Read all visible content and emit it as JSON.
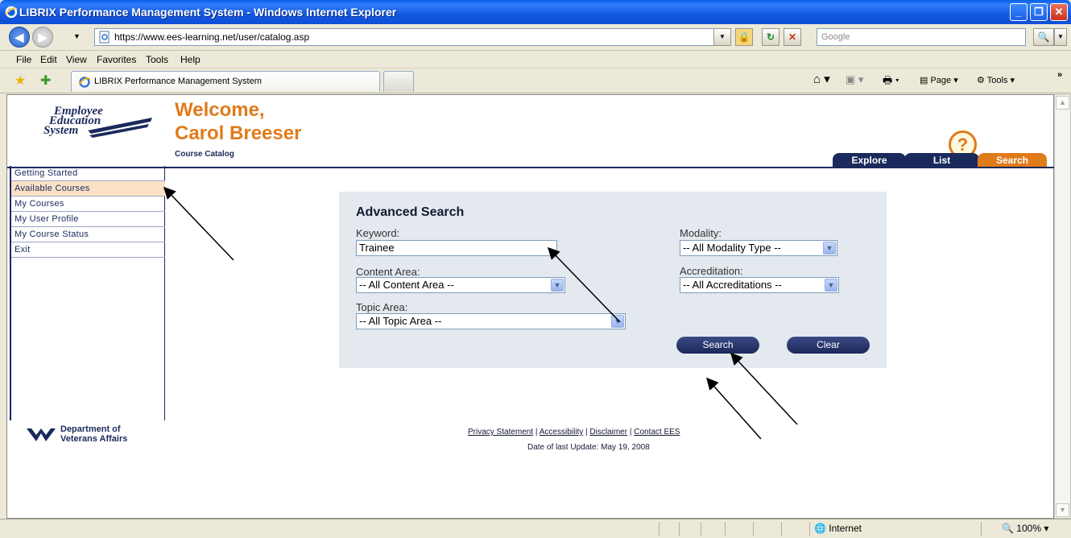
{
  "window": {
    "title": "LIBRIX Performance Management System - Windows Internet Explorer"
  },
  "address": {
    "url": "https://www.ees-learning.net/user/catalog.asp",
    "search_placeholder": "Google"
  },
  "menu": [
    "File",
    "Edit",
    "View",
    "Favorites",
    "Tools",
    "Help"
  ],
  "browser_tab": {
    "label": "LIBRIX Performance Management System"
  },
  "toolbar": {
    "page_label": "Page",
    "tools_label": "Tools"
  },
  "page": {
    "logo": {
      "line1": "Employee",
      "line2": "Education",
      "line3": "System"
    },
    "welcome_line1": "Welcome,",
    "welcome_line2": "Carol Breeser",
    "section": "Course Catalog",
    "help_icon_glyph": "?",
    "tabs": [
      "Explore",
      "List",
      "Search"
    ],
    "left_nav": [
      "Getting Started",
      "Available Courses",
      "My Courses",
      "My User Profile",
      "My Course Status",
      "Exit"
    ],
    "active_nav": "Available Courses"
  },
  "search": {
    "heading": "Advanced Search",
    "keyword_label": "Keyword:",
    "keyword_value": "Trainee",
    "content_area_label": "Content Area:",
    "content_area_value": "-- All Content Area --",
    "topic_area_label": "Topic Area:",
    "topic_area_value": "-- All Topic Area --",
    "modality_label": "Modality:",
    "modality_value": "-- All Modality Type --",
    "accreditation_label": "Accreditation:",
    "accreditation_value": "-- All Accreditations --",
    "search_button": "Search",
    "clear_button": "Clear"
  },
  "footer": {
    "va_line1": "Department of",
    "va_line2": "Veterans Affairs",
    "links": [
      "Privacy Statement",
      "Accessibility",
      "Disclaimer",
      "Contact EES"
    ],
    "separator": " | ",
    "date": "Date of last Update: May 19, 2008"
  },
  "status": {
    "zone": "Internet",
    "zoom": "100%"
  },
  "colors": {
    "accent_orange": "#e07b1a",
    "navy": "#1a2a5c",
    "panel": "#e3e9ef"
  }
}
